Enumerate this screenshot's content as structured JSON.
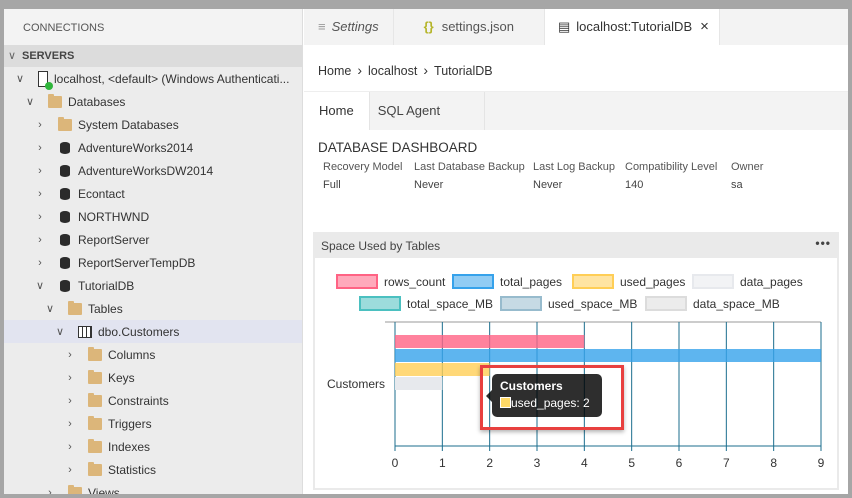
{
  "sidebar": {
    "title": "CONNECTIONS",
    "section": "SERVERS",
    "tree": [
      {
        "label": "localhost, <default> (Windows Authenticati...",
        "level": 0,
        "icon": "server-icon",
        "expanded": true
      },
      {
        "label": "Databases",
        "level": 1,
        "icon": "folder-icon",
        "expanded": true
      },
      {
        "label": "System Databases",
        "level": 2,
        "icon": "folder-icon",
        "expanded": false
      },
      {
        "label": "AdventureWorks2014",
        "level": 2,
        "icon": "database-icon",
        "expanded": false
      },
      {
        "label": "AdventureWorksDW2014",
        "level": 2,
        "icon": "database-icon",
        "expanded": false
      },
      {
        "label": "Econtact",
        "level": 2,
        "icon": "database-icon",
        "expanded": false
      },
      {
        "label": "NORTHWND",
        "level": 2,
        "icon": "database-icon",
        "expanded": false
      },
      {
        "label": "ReportServer",
        "level": 2,
        "icon": "database-icon",
        "expanded": false
      },
      {
        "label": "ReportServerTempDB",
        "level": 2,
        "icon": "database-icon",
        "expanded": false
      },
      {
        "label": "TutorialDB",
        "level": 2,
        "icon": "database-icon",
        "expanded": true
      },
      {
        "label": "Tables",
        "level": 3,
        "icon": "folder-icon",
        "expanded": true
      },
      {
        "label": "dbo.Customers",
        "level": 4,
        "icon": "table-icon",
        "expanded": true,
        "selected": true
      },
      {
        "label": "Columns",
        "level": 5,
        "icon": "folder-icon",
        "expanded": false
      },
      {
        "label": "Keys",
        "level": 5,
        "icon": "folder-icon",
        "expanded": false
      },
      {
        "label": "Constraints",
        "level": 5,
        "icon": "folder-icon",
        "expanded": false
      },
      {
        "label": "Triggers",
        "level": 5,
        "icon": "folder-icon",
        "expanded": false
      },
      {
        "label": "Indexes",
        "level": 5,
        "icon": "folder-icon",
        "expanded": false
      },
      {
        "label": "Statistics",
        "level": 5,
        "icon": "folder-icon",
        "expanded": false
      },
      {
        "label": "Views",
        "level": 3,
        "icon": "folder-icon",
        "expanded": false
      }
    ]
  },
  "tabs": [
    {
      "label": "Settings",
      "icon": "≡"
    },
    {
      "label": "settings.json",
      "icon": "{}"
    },
    {
      "label": "localhost:TutorialDB",
      "icon": "▤",
      "active": true,
      "close": "×"
    }
  ],
  "breadcrumb": [
    "Home",
    "localhost",
    "TutorialDB"
  ],
  "dashboard_tabs": [
    "Home",
    "SQL Agent"
  ],
  "dashboard": {
    "title": "DATABASE DASHBOARD",
    "properties": [
      {
        "label": "Recovery Model",
        "value": "Full"
      },
      {
        "label": "Last Database Backup",
        "value": "Never"
      },
      {
        "label": "Last Log Backup",
        "value": "Never"
      },
      {
        "label": "Compatibility Level",
        "value": "140"
      },
      {
        "label": "Owner",
        "value": "sa"
      }
    ]
  },
  "widget": {
    "title": "Space Used by Tables",
    "menu": "•••"
  },
  "chart_data": {
    "type": "bar",
    "orientation": "horizontal",
    "categories": [
      "Customers"
    ],
    "series": [
      {
        "name": "rows_count",
        "values": [
          4
        ],
        "color": "#ff6384"
      },
      {
        "name": "total_pages",
        "values": [
          9
        ],
        "color": "#36a2eb"
      },
      {
        "name": "used_pages",
        "values": [
          2
        ],
        "color": "#ffce56"
      },
      {
        "name": "data_pages",
        "values": [
          1
        ],
        "color": "#e7e9ed"
      },
      {
        "name": "total_space_MB",
        "values": [
          0
        ],
        "color": "#4bc0c0"
      },
      {
        "name": "used_space_MB",
        "values": [
          0
        ],
        "color": "#97bbcd"
      },
      {
        "name": "data_space_MB",
        "values": [
          0
        ],
        "color": "#dcdcdc"
      }
    ],
    "xlim": [
      0,
      9
    ],
    "xticks": [
      0,
      1,
      2,
      3,
      4,
      5,
      6,
      7,
      8,
      9
    ],
    "grid": true,
    "legend": "top",
    "tooltip": {
      "title": "Customers",
      "text": "used_pages: 2"
    }
  }
}
